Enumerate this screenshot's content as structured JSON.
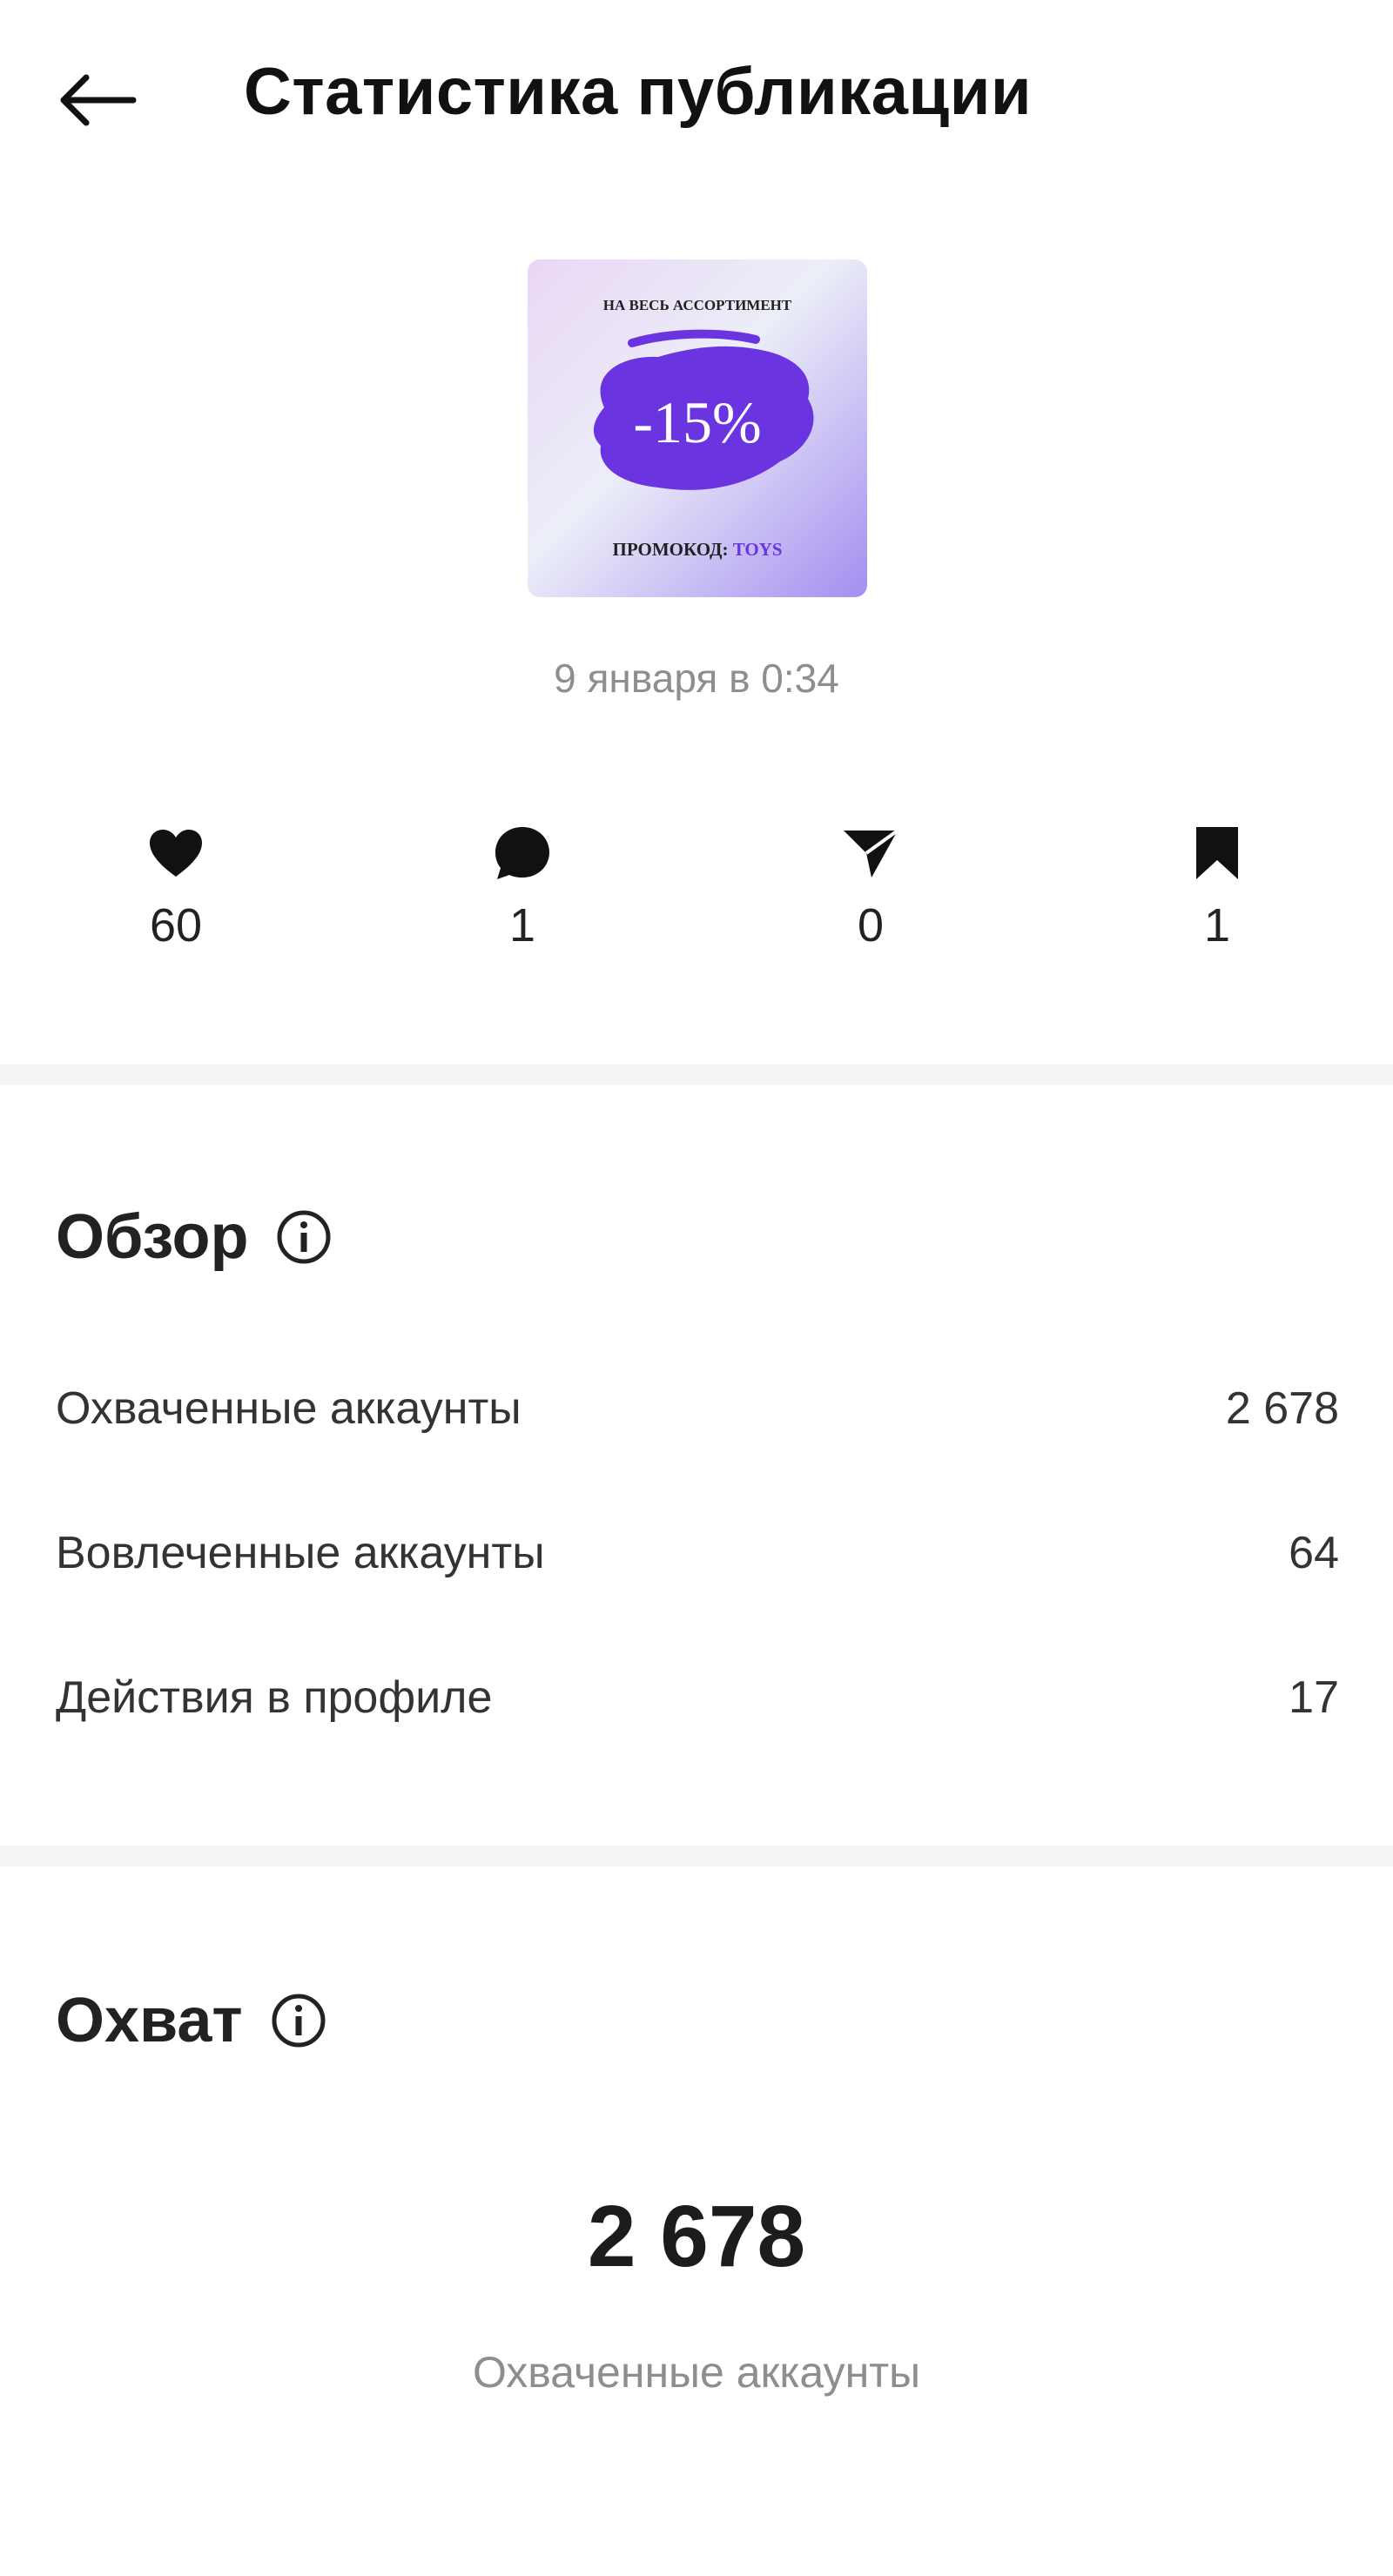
{
  "header": {
    "title": "Статистика публикации",
    "back_icon": "arrow-left-icon"
  },
  "post": {
    "image": {
      "top_text": "НА ВЕСЬ АССОРТИМЕНТ",
      "discount": "-15%",
      "promo_label": "ПРОМОКОД:",
      "promo_code": "TOYS",
      "accent_color": "#6a35e0"
    },
    "date": "9 января в 0:34"
  },
  "engagement": [
    {
      "icon": "heart-icon",
      "value": "60"
    },
    {
      "icon": "comment-icon",
      "value": "1"
    },
    {
      "icon": "share-icon",
      "value": "0"
    },
    {
      "icon": "bookmark-icon",
      "value": "1"
    }
  ],
  "overview": {
    "title": "Обзор",
    "info_icon": "info-icon",
    "rows": [
      {
        "label": "Охваченные аккаунты",
        "value": "2 678"
      },
      {
        "label": "Вовлеченные аккаунты",
        "value": "64"
      },
      {
        "label": "Действия в профиле",
        "value": "17"
      }
    ]
  },
  "reach": {
    "title": "Охват",
    "info_icon": "info-icon",
    "value": "2 678",
    "caption": "Охваченные аккаунты"
  }
}
